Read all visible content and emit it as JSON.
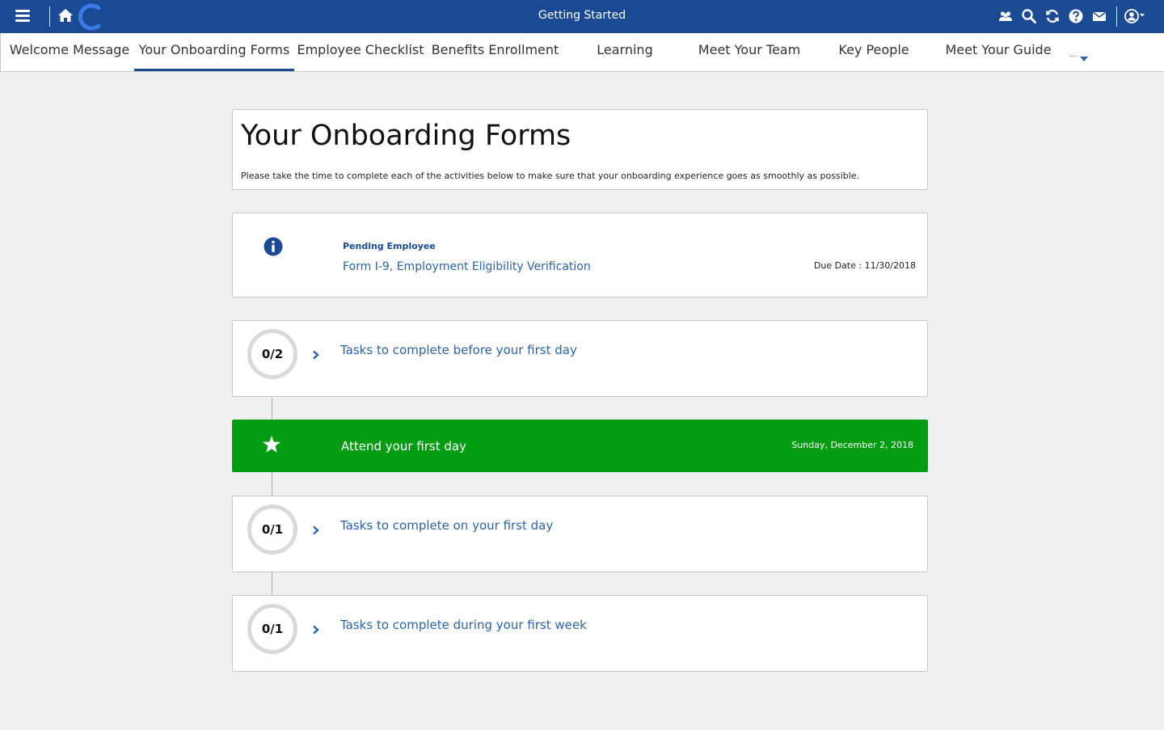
{
  "topbar": {
    "title": "Getting Started",
    "logo_letter": "C",
    "icons": [
      "menu-icon",
      "home-icon",
      "people-icon",
      "search-icon",
      "refresh-icon",
      "help-icon",
      "mail-icon",
      "user-icon"
    ]
  },
  "nav": {
    "tabs": [
      {
        "label": "Welcome Message"
      },
      {
        "label": "Your Onboarding Forms",
        "active": true
      },
      {
        "label": "Employee Checklist"
      },
      {
        "label": "Benefits Enrollment"
      },
      {
        "label": "Learning"
      },
      {
        "label": "Meet Your Team"
      },
      {
        "label": "Key People"
      },
      {
        "label": "Meet Your Guide"
      }
    ],
    "more_label": "..."
  },
  "header": {
    "title": "Your Onboarding Forms",
    "description": "Please take the time to complete each of the activities below to make sure that your onboarding experience goes as smoothly as possible."
  },
  "pending": {
    "label": "Pending Employee",
    "form": "Form I-9, Employment Eligibility Verification",
    "due_label": "Due Date :",
    "due_date": "11/30/2018"
  },
  "tasks": [
    {
      "progress": "0/2",
      "label": "Tasks to complete before your first day"
    },
    {
      "progress": "0/1",
      "label": "Tasks to complete on your first day"
    },
    {
      "progress": "0/1",
      "label": "Tasks to complete during your first week"
    }
  ],
  "first_day": {
    "label": "Attend your first day",
    "date": "Sunday, December 2, 2018"
  },
  "colors": {
    "topbar": "#1b4a94",
    "link": "#2a64a8",
    "first_day_bg": "#029c13",
    "background": "#f0f0f0"
  }
}
